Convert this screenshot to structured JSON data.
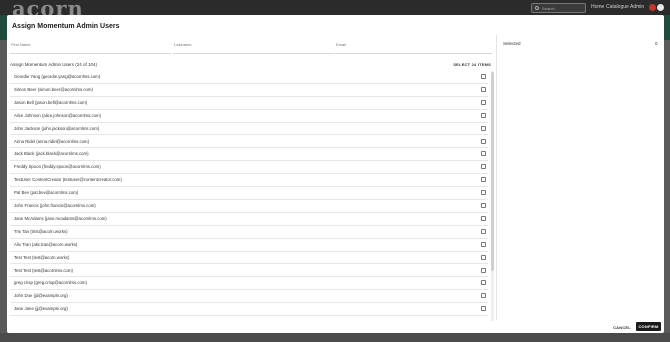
{
  "background": {
    "logo": "acorn",
    "search_placeholder": "Search",
    "nav": [
      "Home",
      "Catalogue",
      "Admin"
    ]
  },
  "modal": {
    "title": "Assign Momentum Admin Users",
    "fields": {
      "first_name_label": "First Name",
      "last_name_label": "Lastname",
      "email_label": "Email"
    },
    "list_title": "Assign Momentum Admin Users (24 of 104)",
    "select_all_label": "SELECT 24 ITEMS",
    "users": [
      "Geordie Yang (geordie.yang@acornlms.com)",
      "Simon Beer (simon.beer@acornlms.com)",
      "Jason Bell (jason.bell@acornlms.com)",
      "Alice Johnson (alice.johnson@acornlms.com)",
      "John Jackson (john.jackson@acornlms.com)",
      "Anna Ridel (anna.ridel@acornlms.com)",
      "Jack Black (jack.black@acornlms.com)",
      "Freddy Spoon (freddy.spoon@acornlms.com)",
      "TestUser ContentCreator (testuser@contentcreator.com)",
      "Pat Bev (pat.bev@acornlms.com)",
      "John Francis (john.francis@acornlms.com)",
      "Jane McAdams (jane.mcadams@acornlms.com)",
      "Tris Tan (trist@acorn.works)",
      "Alix Tran (alix.tran@acorn.works)",
      "Test Test (test@acorn.works)",
      "Test Test (test@acornlms.com)",
      "greg crisp (greg.crisp@acornlms.com)",
      "John Doe (jd@example.org)",
      "Jane Jane (jj@example.org)"
    ],
    "selected_label": "Selected",
    "selected_count": "0",
    "cancel_label": "CANCEL",
    "confirm_label": "CONFIRM"
  }
}
